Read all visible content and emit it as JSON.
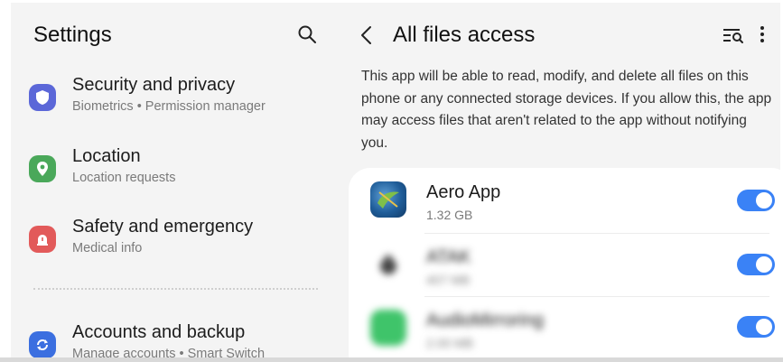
{
  "settings": {
    "title": "Settings",
    "search_icon": "search-icon",
    "items": [
      {
        "title": "Security and privacy",
        "subtitle": "Biometrics  •  Permission manager",
        "icon": "shield-icon",
        "color": "#5b67d8"
      },
      {
        "title": "Location",
        "subtitle": "Location requests",
        "icon": "location-pin-icon",
        "color": "#4aa85a"
      },
      {
        "title": "Safety and emergency",
        "subtitle": "Medical info",
        "icon": "siren-icon",
        "color": "#e25a5a"
      },
      {
        "title": "Accounts and backup",
        "subtitle": "Manage accounts  •  Smart Switch",
        "icon": "sync-icon",
        "color": "#3b6fe0"
      }
    ]
  },
  "detail": {
    "title": "All files access",
    "back_icon": "back-arrow-icon",
    "filter_icon": "filter-search-icon",
    "more_icon": "more-vert-icon",
    "description": "This app will be able to read, modify, and delete all files on this phone or any connected storage devices. If you allow this, the app may access files that aren't related to the app without notifying you.",
    "apps": [
      {
        "name": "Aero App",
        "size": "1.32 GB",
        "enabled": true,
        "blurred": false
      },
      {
        "name": "ATAK",
        "size": "407 MB",
        "enabled": true,
        "blurred": true
      },
      {
        "name": "AudioMirroring",
        "size": "2.00 MB",
        "enabled": true,
        "blurred": true
      }
    ]
  },
  "colors": {
    "accent": "#3a82f6",
    "background": "#f4f4f4",
    "card": "#ffffff"
  }
}
